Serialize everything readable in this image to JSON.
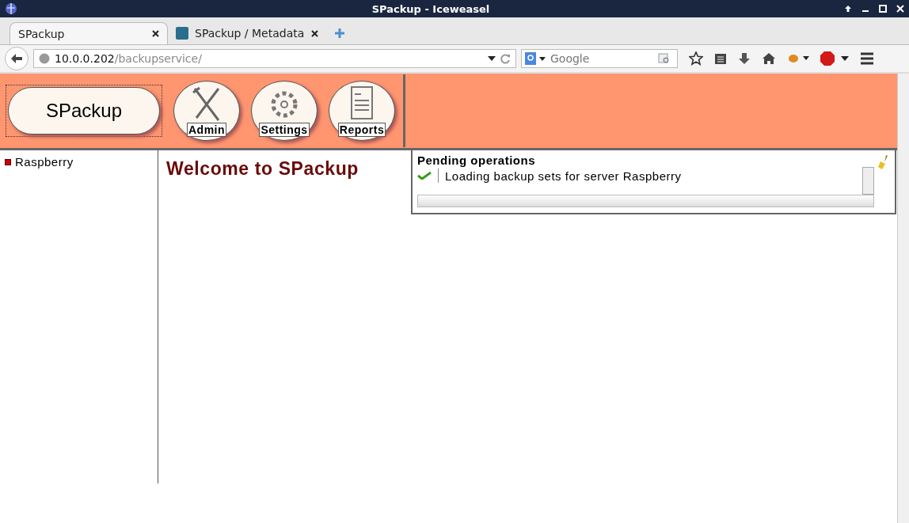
{
  "window": {
    "title": "SPackup - Iceweasel"
  },
  "tabs": [
    {
      "label": "SPackup",
      "selected": true,
      "favicon": false
    },
    {
      "label": "SPackup / Metadata",
      "selected": false,
      "favicon": true
    }
  ],
  "address": {
    "host": "10.0.0.202",
    "path": "/backupservice/"
  },
  "search": {
    "placeholder": "Google"
  },
  "header": {
    "logo": "SPackup",
    "buttons": [
      {
        "label": "Admin",
        "kind": "tools"
      },
      {
        "label": "Settings",
        "kind": "gear"
      },
      {
        "label": "Reports",
        "kind": "report"
      }
    ]
  },
  "sidebar": {
    "items": [
      {
        "label": "Raspberry",
        "color": "#cc0000"
      }
    ]
  },
  "main": {
    "heading": "Welcome to SPackup"
  },
  "pending": {
    "title": "Pending operations",
    "operations": [
      {
        "text": "Loading backup sets for server Raspberry",
        "done": true
      }
    ]
  }
}
